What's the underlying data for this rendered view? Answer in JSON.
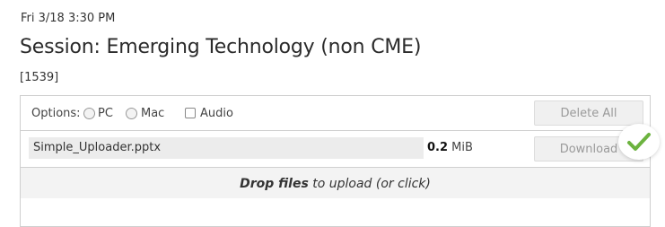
{
  "header": {
    "datetime": "Fri 3/18 3:30 PM",
    "title": "Session: Emerging Technology (non CME)",
    "code": "[1539]"
  },
  "uploader": {
    "options_label": "Options:",
    "options": [
      {
        "label": "PC",
        "type": "radio",
        "selected": false
      },
      {
        "label": "Mac",
        "type": "radio",
        "selected": false
      },
      {
        "label": "Audio",
        "type": "checkbox",
        "checked": false
      }
    ],
    "delete_all_label": "Delete All",
    "files": [
      {
        "name": "Simple_Uploader.pptx",
        "size_value": "0.2",
        "size_unit": "MiB",
        "download_label": "Download",
        "status_icon": "checkmark-icon",
        "status_color": "#6cb33f"
      }
    ],
    "dropzone": {
      "bold": "Drop files",
      "rest": " to upload (or click)"
    }
  }
}
